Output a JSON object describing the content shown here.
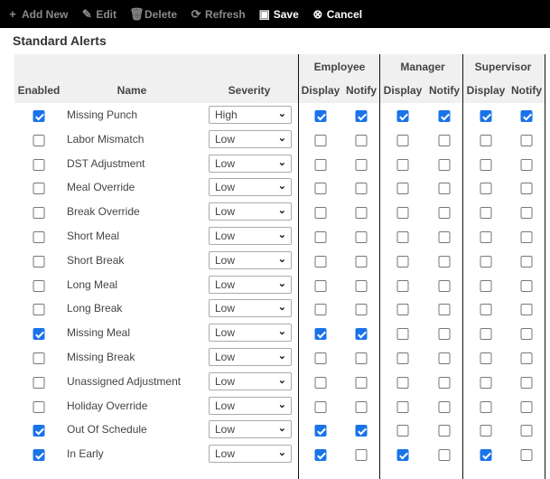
{
  "toolbar": [
    {
      "label": "Add New",
      "icon": "plus-icon",
      "glyph": "+",
      "enabled": false
    },
    {
      "label": "Edit",
      "icon": "edit-icon",
      "glyph": "✎",
      "enabled": false
    },
    {
      "label": "Delete",
      "icon": "trash-icon",
      "glyph": "🗑",
      "enabled": false
    },
    {
      "label": "Refresh",
      "icon": "refresh-icon",
      "glyph": "⟳",
      "enabled": false
    },
    {
      "label": "Save",
      "icon": "floppy-disk-icon",
      "glyph": "▣",
      "enabled": true
    },
    {
      "label": "Cancel",
      "icon": "cancel-circle-icon",
      "glyph": "⊗",
      "enabled": true
    }
  ],
  "section_title": "Standard Alerts",
  "headers": {
    "enabled": "Enabled",
    "name": "Name",
    "severity": "Severity",
    "groups": [
      "Employee",
      "Manager",
      "Supervisor"
    ],
    "display": "Display",
    "notify": "Notify"
  },
  "colors": {
    "checked": "#1a73e8",
    "toolbar_bg": "#000000"
  },
  "rows": [
    {
      "enabled": true,
      "name": "Missing Punch",
      "severity": "High",
      "checks": [
        true,
        true,
        true,
        true,
        true,
        true
      ]
    },
    {
      "enabled": false,
      "name": "Labor Mismatch",
      "severity": "Low",
      "checks": [
        false,
        false,
        false,
        false,
        false,
        false
      ]
    },
    {
      "enabled": false,
      "name": "DST Adjustment",
      "severity": "Low",
      "checks": [
        false,
        false,
        false,
        false,
        false,
        false
      ]
    },
    {
      "enabled": false,
      "name": "Meal Override",
      "severity": "Low",
      "checks": [
        false,
        false,
        false,
        false,
        false,
        false
      ]
    },
    {
      "enabled": false,
      "name": "Break Override",
      "severity": "Low",
      "checks": [
        false,
        false,
        false,
        false,
        false,
        false
      ]
    },
    {
      "enabled": false,
      "name": "Short Meal",
      "severity": "Low",
      "checks": [
        false,
        false,
        false,
        false,
        false,
        false
      ]
    },
    {
      "enabled": false,
      "name": "Short Break",
      "severity": "Low",
      "checks": [
        false,
        false,
        false,
        false,
        false,
        false
      ]
    },
    {
      "enabled": false,
      "name": "Long Meal",
      "severity": "Low",
      "checks": [
        false,
        false,
        false,
        false,
        false,
        false
      ]
    },
    {
      "enabled": false,
      "name": "Long Break",
      "severity": "Low",
      "checks": [
        false,
        false,
        false,
        false,
        false,
        false
      ]
    },
    {
      "enabled": true,
      "name": "Missing Meal",
      "severity": "Low",
      "checks": [
        true,
        true,
        false,
        false,
        false,
        false
      ]
    },
    {
      "enabled": false,
      "name": "Missing Break",
      "severity": "Low",
      "checks": [
        false,
        false,
        false,
        false,
        false,
        false
      ]
    },
    {
      "enabled": false,
      "name": "Unassigned Adjustment",
      "severity": "Low",
      "checks": [
        false,
        false,
        false,
        false,
        false,
        false
      ]
    },
    {
      "enabled": false,
      "name": "Holiday Override",
      "severity": "Low",
      "checks": [
        false,
        false,
        false,
        false,
        false,
        false
      ]
    },
    {
      "enabled": true,
      "name": "Out Of Schedule",
      "severity": "Low",
      "checks": [
        true,
        true,
        false,
        false,
        false,
        false
      ]
    },
    {
      "enabled": true,
      "name": "In Early",
      "severity": "Low",
      "checks": [
        true,
        false,
        true,
        false,
        true,
        false
      ]
    }
  ]
}
